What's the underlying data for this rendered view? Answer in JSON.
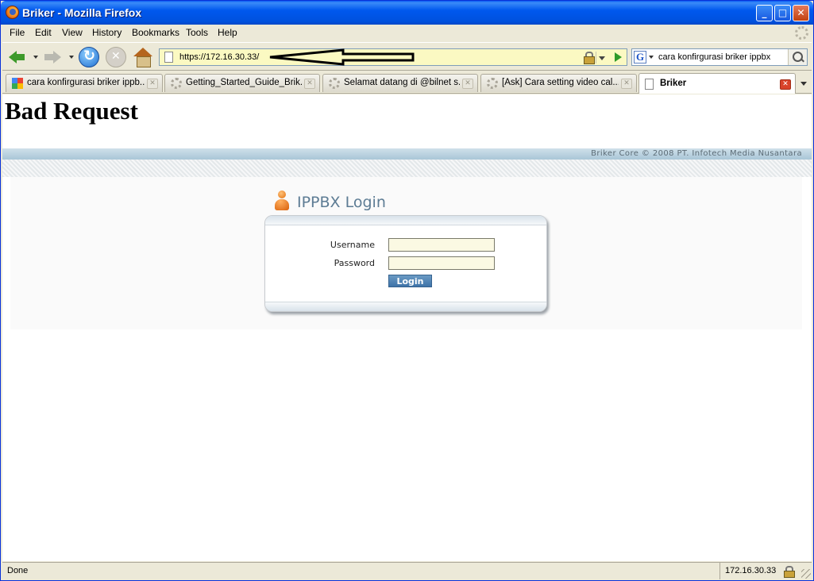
{
  "window": {
    "title": "Briker - Mozilla Firefox",
    "minimize": "_",
    "maximize": "□",
    "close": "✕"
  },
  "menu": {
    "items": [
      "File",
      "Edit",
      "View",
      "History",
      "Bookmarks",
      "Tools",
      "Help"
    ]
  },
  "nav": {
    "url": "https://172.16.30.33/",
    "search_engine_glyph": "G",
    "search_text": "cara konfirgurasi briker ippbx"
  },
  "tabs": [
    {
      "label": "cara konfirgurasi briker ippb...",
      "icon": "google-icon",
      "active": false
    },
    {
      "label": "Getting_Started_Guide_Brik...",
      "icon": "loading-icon",
      "active": false
    },
    {
      "label": "Selamat datang di @bilnet s...",
      "icon": "loading-icon",
      "active": false
    },
    {
      "label": "[Ask] Cara setting video cal...",
      "icon": "loading-icon",
      "active": false
    },
    {
      "label": "Briker",
      "icon": "page-icon",
      "active": true
    }
  ],
  "page": {
    "heading": "Bad Request",
    "copyright": "Briker Core © 2008 PT. Infotech Media Nusantara",
    "login": {
      "title": "IPPBX Login",
      "username_label": "Username",
      "password_label": "Password",
      "button_label": "Login",
      "username_value": "",
      "password_value": ""
    }
  },
  "status": {
    "text": "Done",
    "host": "172.16.30.33"
  },
  "colors": {
    "titlebar": "#0058ee",
    "url_bg": "#fbf9c2",
    "login_title": "#5d7c94",
    "login_button": "#3e73a8"
  }
}
